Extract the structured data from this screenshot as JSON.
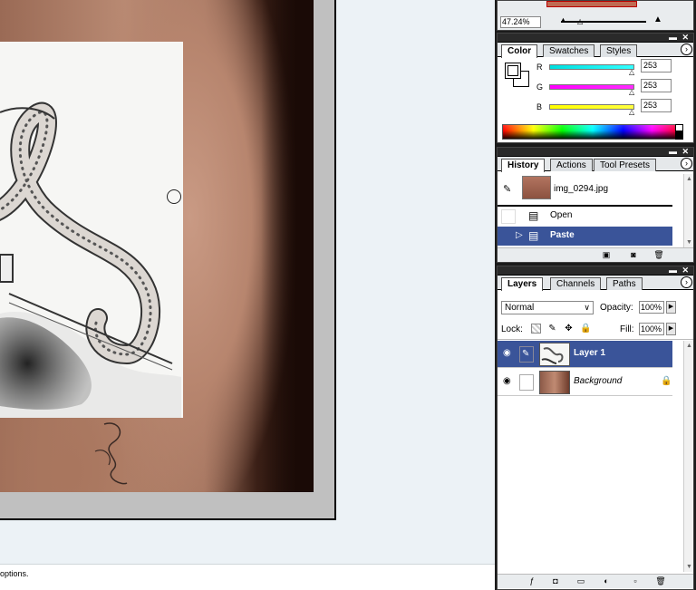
{
  "status_bar": {
    "text": "options."
  },
  "navigator": {
    "zoom": "47.24%"
  },
  "color_palette": {
    "tabs": [
      "Color",
      "Swatches",
      "Styles"
    ],
    "active_tab": "Color",
    "sliders": [
      {
        "label": "R",
        "value": "253",
        "gradient": "#00e0e0,#40ffff"
      },
      {
        "label": "G",
        "value": "253",
        "gradient": "#ff00ff,#ff00ff"
      },
      {
        "label": "B",
        "value": "253",
        "gradient": "#ffff00,#ffff30"
      }
    ]
  },
  "history_palette": {
    "tabs": [
      "History",
      "Actions",
      "Tool Presets"
    ],
    "active_tab": "History",
    "snapshot_name": "img_0294.jpg",
    "states": [
      {
        "label": "Open",
        "selected": false
      },
      {
        "label": "Paste",
        "selected": true
      }
    ]
  },
  "layers_palette": {
    "tabs": [
      "Layers",
      "Channels",
      "Paths"
    ],
    "active_tab": "Layers",
    "blend_mode": "Normal",
    "opacity_label": "Opacity:",
    "opacity_value": "100%",
    "lock_label": "Lock:",
    "fill_label": "Fill:",
    "fill_value": "100%",
    "layers": [
      {
        "name": "Layer 1",
        "selected": true,
        "visible": true
      },
      {
        "name": "Background",
        "selected": false,
        "visible": true,
        "locked": true
      }
    ]
  },
  "colors": {
    "selection": "#3a5499",
    "dock_bg": "#1b1b1b",
    "workspace_bg": "#ecf2f6"
  }
}
